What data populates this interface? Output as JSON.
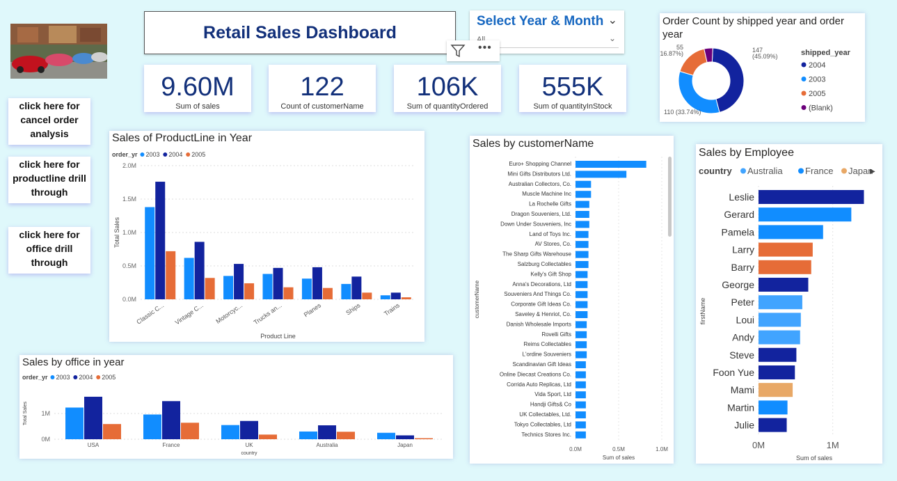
{
  "header": {
    "title": "Retail Sales Dashboard"
  },
  "slicer": {
    "title": "Select Year & Month",
    "value": "All"
  },
  "kpis": [
    {
      "value": "9.60M",
      "label": "Sum of sales"
    },
    {
      "value": "122",
      "label": "Count of customerName"
    },
    {
      "value": "106K",
      "label": "Sum of quantityOrdered"
    },
    {
      "value": "555K",
      "label": "Sum of quantityInStock"
    }
  ],
  "nav": {
    "cancel": "click here for cancel order analysis",
    "productline": "click here for productline drill through",
    "office": "click here for office drill through"
  },
  "colors": {
    "y2003": "#118dff",
    "y2004": "#12239e",
    "y2005": "#e66c37",
    "blank": "#6b007b",
    "japan": "#e8a866",
    "australia": "#41a4ff"
  },
  "chart_data": [
    {
      "id": "order_count",
      "type": "pie",
      "title": "Order Count by shipped year and order year",
      "legend_title": "shipped_year",
      "legend_position": "right",
      "slices": [
        {
          "name": "2004",
          "value": 147,
          "label": "147 (45.09%)"
        },
        {
          "name": "2003",
          "value": 110,
          "label": "110 (33.74%)"
        },
        {
          "name": "2005",
          "value": 55,
          "label": "55 (16.87%)"
        },
        {
          "name": "(Blank)",
          "value": 14,
          "label": ""
        }
      ]
    },
    {
      "id": "productline",
      "type": "bar",
      "title": "Sales of ProductLine in Year",
      "legend_title": "order_yr",
      "xlabel": "Product Line",
      "ylabel": "Total Sales",
      "ylim": [
        0,
        2000000
      ],
      "yticks": [
        "0.0M",
        "0.5M",
        "1.0M",
        "1.5M",
        "2.0M"
      ],
      "categories": [
        "Classic C...",
        "Vintage C...",
        "Motorcyc...",
        "Trucks an...",
        "Planes",
        "Ships",
        "Trains"
      ],
      "series": [
        {
          "name": "2003",
          "values": [
            1380000,
            620000,
            350000,
            380000,
            310000,
            230000,
            60000
          ]
        },
        {
          "name": "2004",
          "values": [
            1760000,
            860000,
            530000,
            470000,
            480000,
            340000,
            100000
          ]
        },
        {
          "name": "2005",
          "values": [
            720000,
            320000,
            240000,
            180000,
            170000,
            100000,
            30000
          ]
        }
      ]
    },
    {
      "id": "office",
      "type": "bar",
      "title": "Sales by office in year",
      "legend_title": "order_yr",
      "xlabel": "country",
      "ylabel": "Total Sales",
      "ylim": [
        0,
        2000000
      ],
      "yticks": [
        "0M",
        "1M"
      ],
      "categories": [
        "USA",
        "France",
        "UK",
        "Australia",
        "Japan"
      ],
      "series": [
        {
          "name": "2003",
          "values": [
            1230000,
            960000,
            550000,
            300000,
            250000
          ]
        },
        {
          "name": "2004",
          "values": [
            1650000,
            1480000,
            710000,
            540000,
            150000
          ]
        },
        {
          "name": "2005",
          "values": [
            590000,
            640000,
            180000,
            290000,
            40000
          ]
        }
      ]
    },
    {
      "id": "customer",
      "type": "bar",
      "orientation": "horizontal",
      "title": "Sales by customerName",
      "xlabel": "Sum of sales",
      "ylabel": "customerName",
      "xlim": [
        0,
        1000000
      ],
      "xticks": [
        "0.0M",
        "0.5M",
        "1.0M"
      ],
      "categories": [
        "Euro+ Shopping Channel",
        "Mini Gifts Distributors Ltd.",
        "Australian Collectors, Co.",
        "Muscle Machine Inc",
        "La Rochelle Gifts",
        "Dragon Souveniers, Ltd.",
        "Down Under Souveniers, Inc",
        "Land of Toys Inc.",
        "AV Stores, Co.",
        "The Sharp Gifts Warehouse",
        "Salzburg Collectables",
        "Kelly's Gift Shop",
        "Anna's Decorations, Ltd",
        "Souveniers And Things Co.",
        "Corporate Gift Ideas Co.",
        "Saveley & Henriot, Co.",
        "Danish Wholesale Imports",
        "Rovelli Gifts",
        "Reims Collectables",
        "L'ordine Souveniers",
        "Scandinavian Gift Ideas",
        "Online Diecast Creations Co.",
        "Corrida Auto Replicas, Ltd",
        "Vida Sport, Ltd",
        "Handji Gifts& Co",
        "UK Collectables, Ltd.",
        "Tokyo Collectables, Ltd",
        "Technics Stores Inc."
      ],
      "values": [
        820000,
        590000,
        180000,
        180000,
        160000,
        160000,
        160000,
        150000,
        150000,
        150000,
        150000,
        140000,
        140000,
        140000,
        140000,
        140000,
        130000,
        130000,
        130000,
        130000,
        120000,
        120000,
        120000,
        120000,
        120000,
        120000,
        120000,
        120000
      ]
    },
    {
      "id": "employee",
      "type": "bar",
      "orientation": "horizontal",
      "title": "Sales by Employee",
      "legend_title": "country",
      "legend": [
        "Australia",
        "France",
        "Japan"
      ],
      "xlabel": "Sum of sales",
      "ylabel": "firstName",
      "xlim": [
        0,
        1500000
      ],
      "xticks": [
        "0M",
        "1M"
      ],
      "categories": [
        "Leslie",
        "Gerard",
        "Pamela",
        "Larry",
        "Barry",
        "George",
        "Peter",
        "Loui",
        "Andy",
        "Steve",
        "Foon Yue",
        "Mami",
        "Martin",
        "Julie"
      ],
      "values": [
        1420000,
        1250000,
        870000,
        730000,
        710000,
        670000,
        590000,
        570000,
        560000,
        510000,
        490000,
        460000,
        390000,
        380000
      ],
      "colors": [
        "#12239e",
        "#118dff",
        "#118dff",
        "#e66c37",
        "#e66c37",
        "#12239e",
        "#41a4ff",
        "#41a4ff",
        "#41a4ff",
        "#12239e",
        "#12239e",
        "#e8a866",
        "#118dff",
        "#12239e"
      ]
    }
  ]
}
